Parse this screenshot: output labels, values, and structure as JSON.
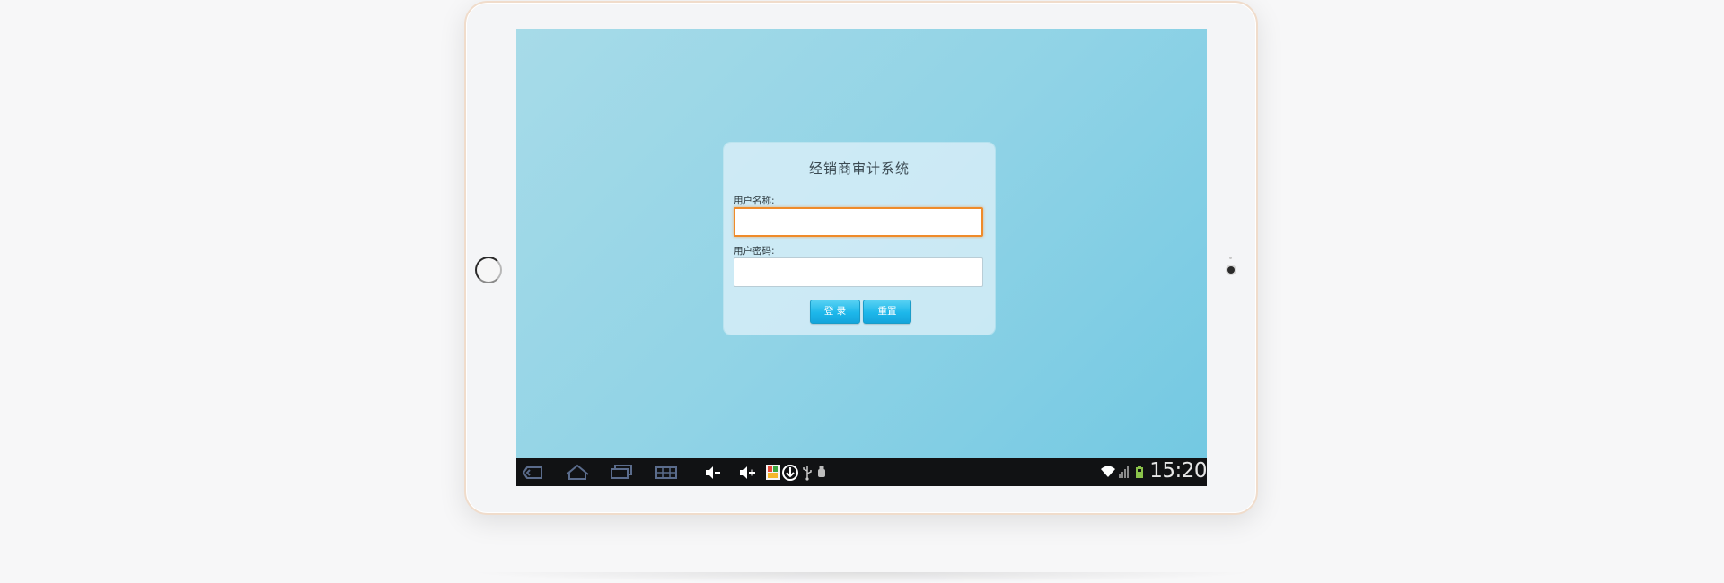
{
  "login": {
    "title": "经销商审计系统",
    "username_label": "用户名称:",
    "username_value": "",
    "password_label": "用户密码:",
    "password_value": "",
    "login_button": "登 录",
    "reset_button": "重置"
  },
  "status_bar": {
    "time": "15:20"
  },
  "colors": {
    "accent_button": "#1db7ea",
    "focus_border": "#ef8b2a",
    "battery": "#8bc34a"
  },
  "icons": [
    "back-icon",
    "home-icon",
    "recent-apps-icon",
    "screenshot-icon",
    "volume-down-icon",
    "volume-up-icon",
    "gallery-notification-icon",
    "download-notification-icon",
    "usb-icon",
    "debug-icon",
    "wifi-icon",
    "signal-icon",
    "battery-icon"
  ]
}
